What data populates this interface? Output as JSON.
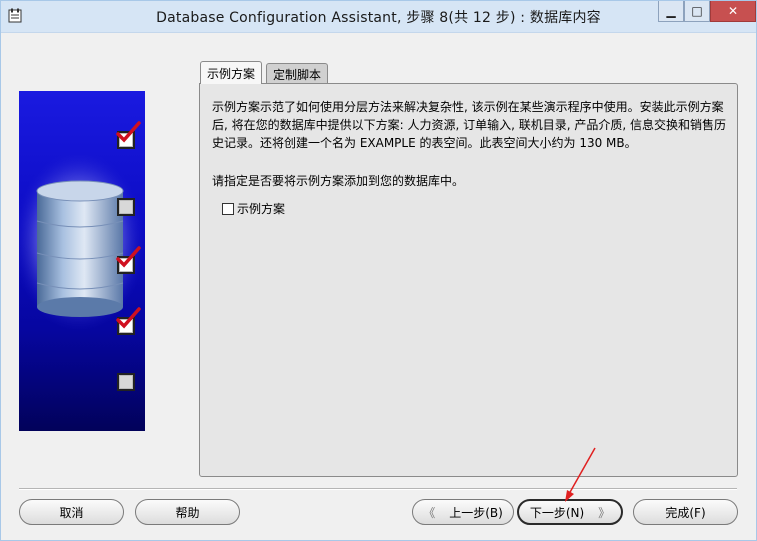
{
  "window": {
    "title": "Database Configuration Assistant, 步骤 8(共 12 步) : 数据库内容",
    "minimize_label": "▁",
    "maximize_label": "□",
    "close_label": "✕"
  },
  "tabs": [
    {
      "label": "示例方案",
      "active": true
    },
    {
      "label": "定制脚本",
      "active": false
    }
  ],
  "panel": {
    "description_line1": "示例方案示范了如何使用分层方法来解决复杂性, 该示例在某些演示程序中使用。安装此示例方案",
    "description_line2": "后, 将在您的数据库中提供以下方案: 人力资源, 订单输入, 联机目录, 产品介质, 信息交换和销售历",
    "description_line3": "史记录。还将创建一个名为 EXAMPLE 的表空间。此表空间大小约为 130 MB。",
    "prompt": "请指定是否要将示例方案添加到您的数据库中。",
    "option_label": "示例方案",
    "option_checked": false
  },
  "side_image": {
    "checks": [
      true,
      false,
      true,
      true,
      false
    ]
  },
  "buttons": {
    "cancel": "取消",
    "help": "帮助",
    "back": "上一步(B)",
    "next": "下一步(N)",
    "finish": "完成(F)",
    "back_arrow": "《",
    "next_arrow": "》"
  },
  "colors": {
    "side_image_top": "#1a1ae0",
    "side_image_bottom": "#02025a",
    "check_red": "#d01020",
    "annotation_red": "#e02020"
  }
}
